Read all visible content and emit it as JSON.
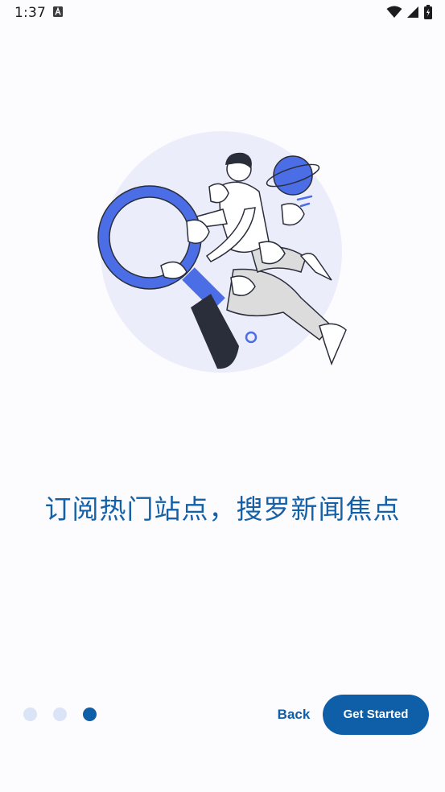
{
  "status_bar": {
    "time": "1:37",
    "notification_icon": "font-a-icon",
    "wifi_icon": "wifi-icon",
    "signal_icon": "cell-signal-icon",
    "battery_icon": "battery-charging-icon"
  },
  "illustration": {
    "icon": "person-with-magnifying-glass-illustration"
  },
  "onboarding": {
    "headline": "订阅热门站点，搜罗新闻焦点",
    "page_count": 3,
    "current_page": 3
  },
  "actions": {
    "back_label": "Back",
    "primary_label": "Get Started"
  },
  "colors": {
    "accent": "#0f5ea8",
    "dot_inactive": "#dbe4f6",
    "background": "#fcfbfe",
    "illustration_blue": "#4b6ee6",
    "illustration_bg": "#ecedfb"
  }
}
